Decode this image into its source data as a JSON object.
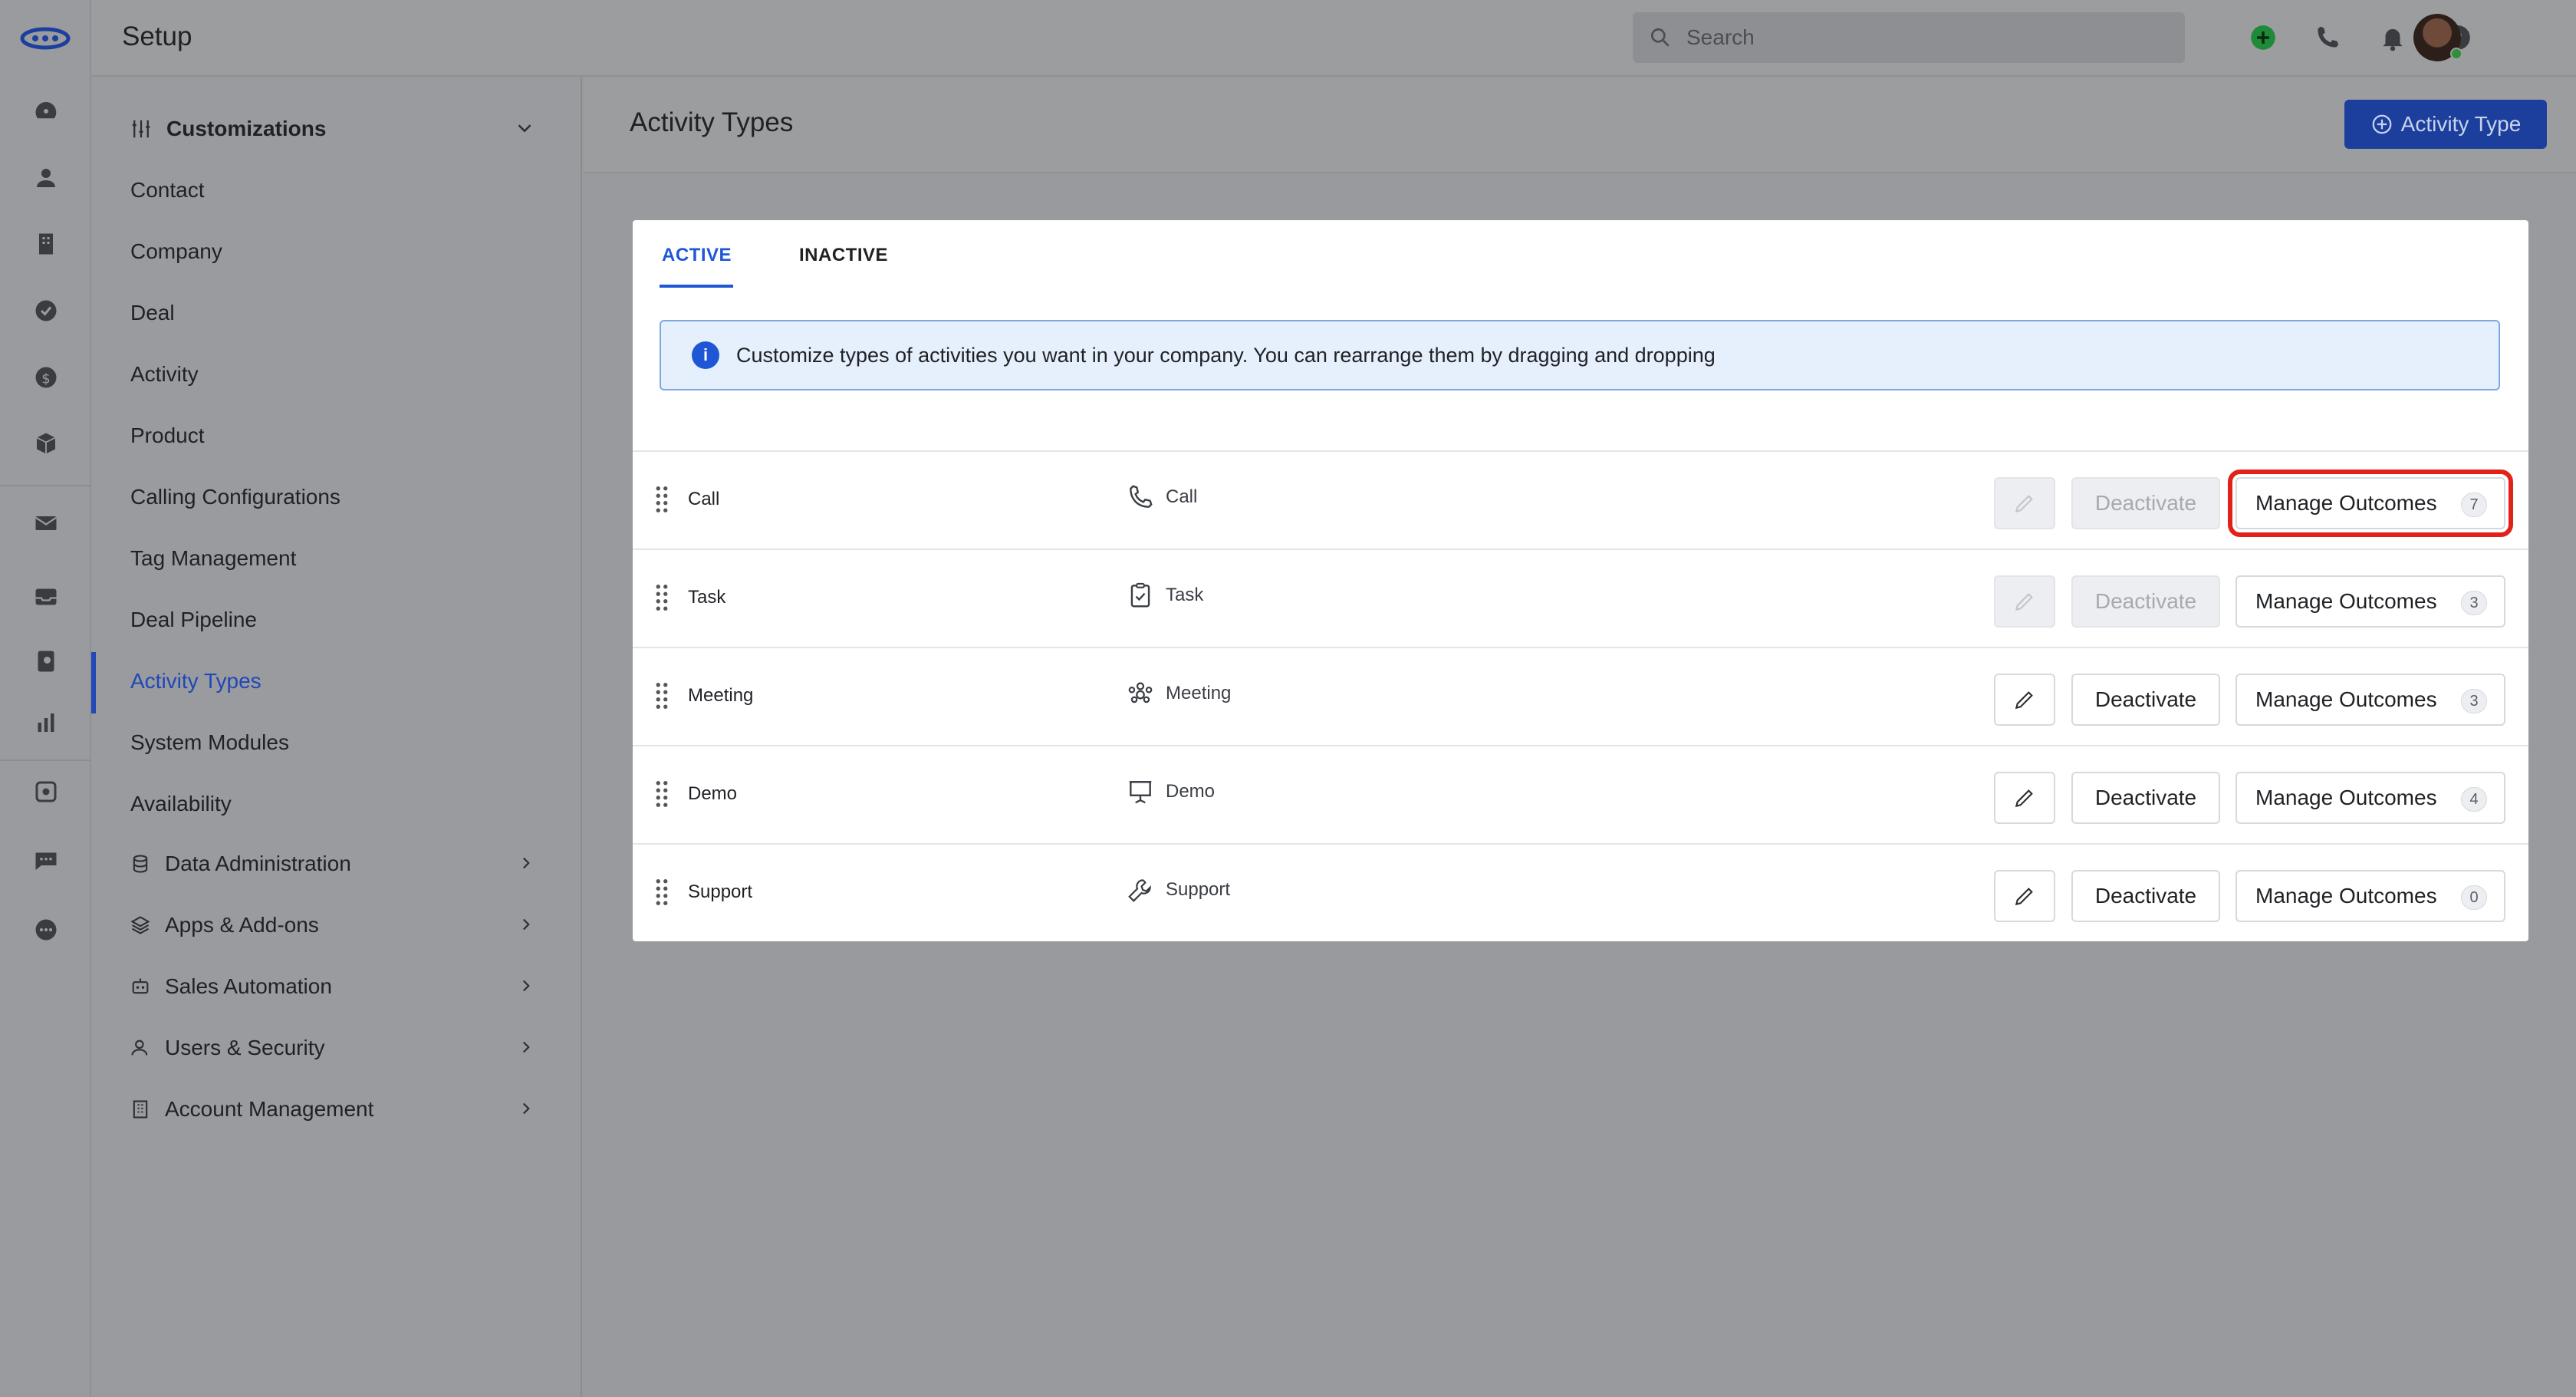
{
  "topbar": {
    "title": "Setup",
    "search_placeholder": "Search"
  },
  "sidebar": {
    "group": "Customizations",
    "items": [
      "Contact",
      "Company",
      "Deal",
      "Activity",
      "Product",
      "Calling Configurations",
      "Tag Management",
      "Deal Pipeline",
      "Activity Types",
      "System Modules",
      "Availability"
    ],
    "active_item": "Activity Types",
    "sections": [
      "Data Administration",
      "Apps & Add-ons",
      "Sales Automation",
      "Users & Security",
      "Account Management"
    ]
  },
  "main": {
    "page_title": "Activity Types",
    "add_button": "Activity Type",
    "tabs": {
      "active": "ACTIVE",
      "inactive": "INACTIVE"
    },
    "info_text": "Customize types of activities you want in your company. You can rearrange them by dragging and dropping",
    "rows": [
      {
        "name": "Call",
        "type": "Call",
        "icon": "phone-icon",
        "deactivate": "Deactivate",
        "manage": "Manage Outcomes",
        "count": "7"
      },
      {
        "name": "Task",
        "type": "Task",
        "icon": "clipboard-check-icon",
        "deactivate": "Deactivate",
        "manage": "Manage Outcomes",
        "count": "3"
      },
      {
        "name": "Meeting",
        "type": "Meeting",
        "icon": "people-icon",
        "deactivate": "Deactivate",
        "manage": "Manage Outcomes",
        "count": "3"
      },
      {
        "name": "Demo",
        "type": "Demo",
        "icon": "presentation-icon",
        "deactivate": "Deactivate",
        "manage": "Manage Outcomes",
        "count": "4"
      },
      {
        "name": "Support",
        "type": "Support",
        "icon": "wrench-icon",
        "deactivate": "Deactivate",
        "manage": "Manage Outcomes",
        "count": "0"
      }
    ]
  },
  "colors": {
    "accent": "#1f56d6",
    "primary_button": "#1c3f9e",
    "highlight": "#e32119",
    "info_bg": "#e6f0fd"
  }
}
